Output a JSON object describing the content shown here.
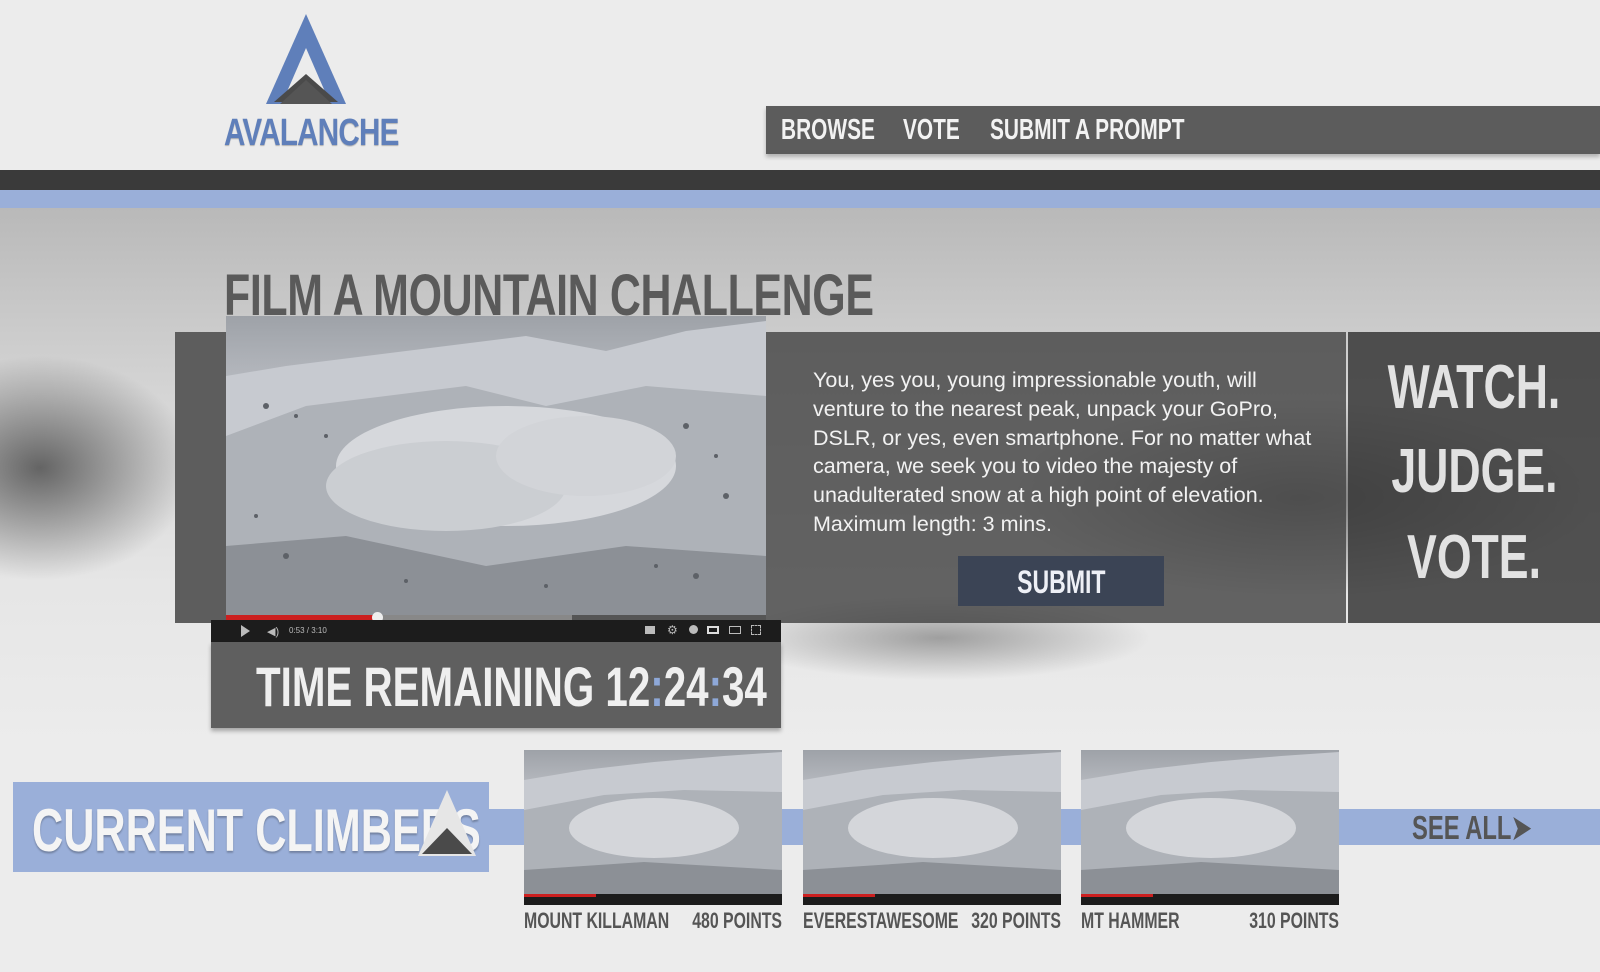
{
  "brand": {
    "name": "AVALANCHE",
    "accent_color": "#5f7fba",
    "icon": "mountain-logo-icon"
  },
  "nav": {
    "items": [
      {
        "label": "BROWSE"
      },
      {
        "label": "VOTE"
      },
      {
        "label": "SUBMIT A PROMPT"
      }
    ]
  },
  "challenge": {
    "title": "FILM A MOUNTAIN CHALLENGE",
    "description": "You, yes you, young impressionable youth, will venture to the nearest peak, unpack your GoPro, DSLR, or yes, even smartphone. For no matter what camera, we seek you to  video the majesty of unadulterated snow at a high point of elevation. Maximum length: 3 mins.",
    "submit_label": "SUBMIT",
    "video": {
      "current_time": "0:53",
      "duration": "3:10",
      "time_display": "0:53 / 3:10",
      "progress": 0.28,
      "buffered": 0.64
    }
  },
  "timer": {
    "label": "TIME REMAINING",
    "hours": "12",
    "minutes": "24",
    "seconds": "34",
    "separator": ":"
  },
  "tagline": {
    "lines": [
      "WATCH.",
      "JUDGE.",
      "VOTE."
    ]
  },
  "climbers": {
    "title": "CURRENT CLIMBERS",
    "see_all_label": "SEE ALL",
    "items": [
      {
        "name": "MOUNT KILLAMAN",
        "points": "480 POINTS",
        "progress": 0.28
      },
      {
        "name": "EVERESTAWESOME",
        "points": "320 POINTS",
        "progress": 0.28
      },
      {
        "name": "MT HAMMER",
        "points": "310 POINTS",
        "progress": 0.28
      }
    ]
  }
}
